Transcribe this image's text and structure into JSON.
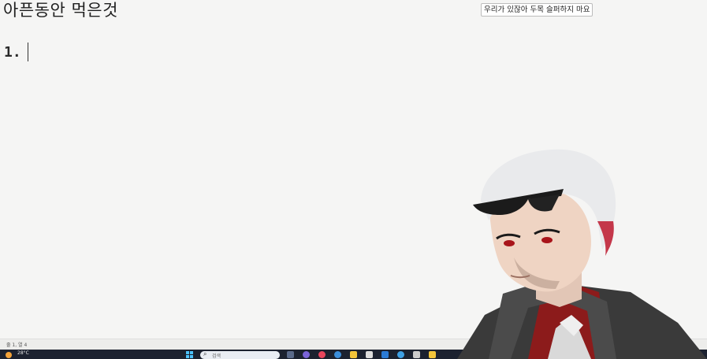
{
  "document": {
    "title": "아픈동안 먹은것",
    "list_item_marker": "1."
  },
  "chat": {
    "message": "우리가 있잖아 두목 슬퍼하지 마요"
  },
  "statusbar": {
    "position": "줄 1, 열 4"
  },
  "taskbar": {
    "weather_temp": "28°C",
    "search_placeholder": "검색",
    "app_icon_colors": [
      "#5a6a8a",
      "#7a63d8",
      "#e8465d",
      "#3b8edb",
      "#1aa6c8",
      "#f2c43a",
      "#dcdcdc",
      "#2b7bd6",
      "#3ea0e4",
      "#2e89ff",
      "#cccccc"
    ]
  },
  "colors": {
    "page_background": "#f5f5f4",
    "taskbar_background": "#1c2230",
    "avatar_shirt": "#8c1b1b",
    "avatar_jacket": "#3a3a3a",
    "avatar_hair": "#e9eaec"
  }
}
